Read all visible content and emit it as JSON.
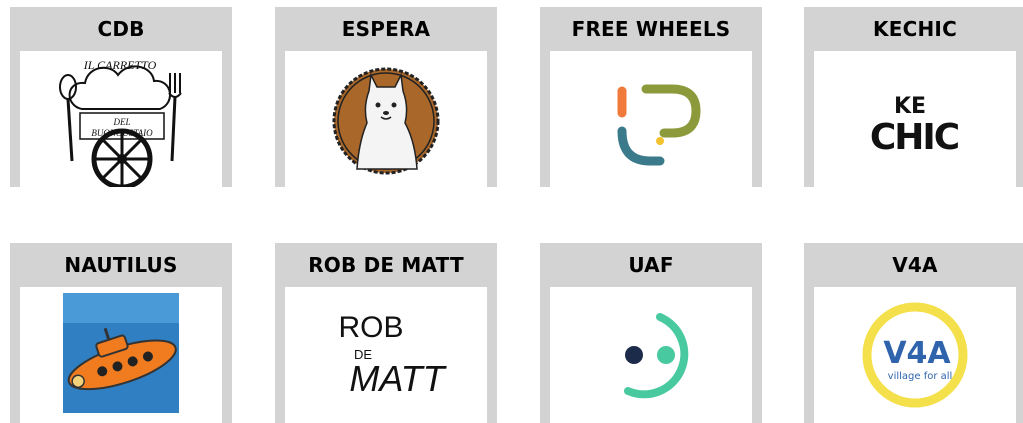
{
  "cards": [
    {
      "title": "CDB",
      "logo_text_top": "IL CARRETTO",
      "logo_text_mid": "DEL",
      "logo_text_bottom": "BUONGUSTAIO"
    },
    {
      "title": "ESPERA"
    },
    {
      "title": "FREE WHEELS"
    },
    {
      "title": "KECHIC",
      "logo_text_top": "KE",
      "logo_text_bottom": "CHIC"
    },
    {
      "title": "NAUTILUS"
    },
    {
      "title": "ROB DE MATT",
      "logo_text_top": "ROB",
      "logo_text_mid": "DE",
      "logo_text_bottom": "MATT"
    },
    {
      "title": "UAF"
    },
    {
      "title": "V4A",
      "logo_text_top": "V4A",
      "logo_text_bottom": "village for all"
    }
  ],
  "colors": {
    "card_bg": "#d3d3d3",
    "logo_bg": "#ffffff",
    "espera_brown": "#a9672a",
    "fw_green": "#8c9a3c",
    "fw_orange": "#f07a3a",
    "fw_teal": "#3a7a8a",
    "fw_yellow": "#f2c230",
    "nautilus_blue": "#2f7fc2",
    "nautilus_orange": "#f07c1f",
    "uaf_green": "#49c9a0",
    "uaf_navy": "#1c2b4a",
    "v4a_yellow": "#f4e04a",
    "v4a_blue": "#2f64ad"
  }
}
